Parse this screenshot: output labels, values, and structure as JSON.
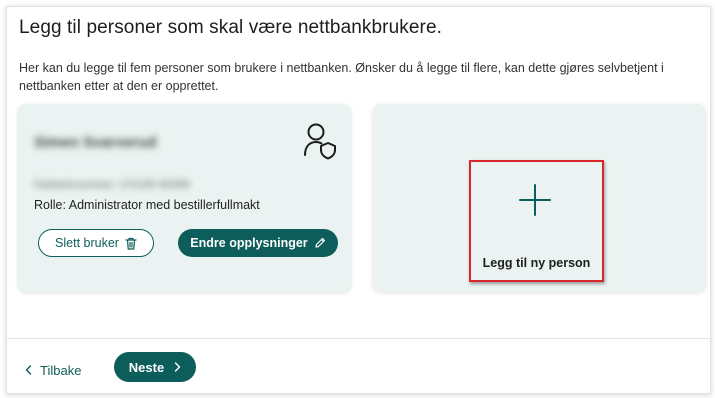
{
  "page": {
    "title": "Legg til personer som skal være nettbankbrukere.",
    "intro": "Her kan du legge til fem personer som brukere i nettbanken. Ønsker du å legge til flere, kan dette gjøres selvbetjent i nettbanken etter at den er opprettet."
  },
  "person_card": {
    "name": "Simen Svarverud",
    "birth_number": "Fødselsnummer: 270185 80989",
    "role": "Rolle: Administrator med bestillerfullmakt",
    "delete_label": "Slett bruker",
    "edit_label": "Endre opplysninger",
    "icon": "person-shield-icon"
  },
  "add_card": {
    "label": "Legg til ny person",
    "icon": "plus-icon",
    "highlight_color": "#d8262d"
  },
  "footer": {
    "back_label": "Tilbake",
    "next_label": "Neste"
  },
  "colors": {
    "accent": "#0d5d5b",
    "card_bg": "#eaf3f1"
  }
}
